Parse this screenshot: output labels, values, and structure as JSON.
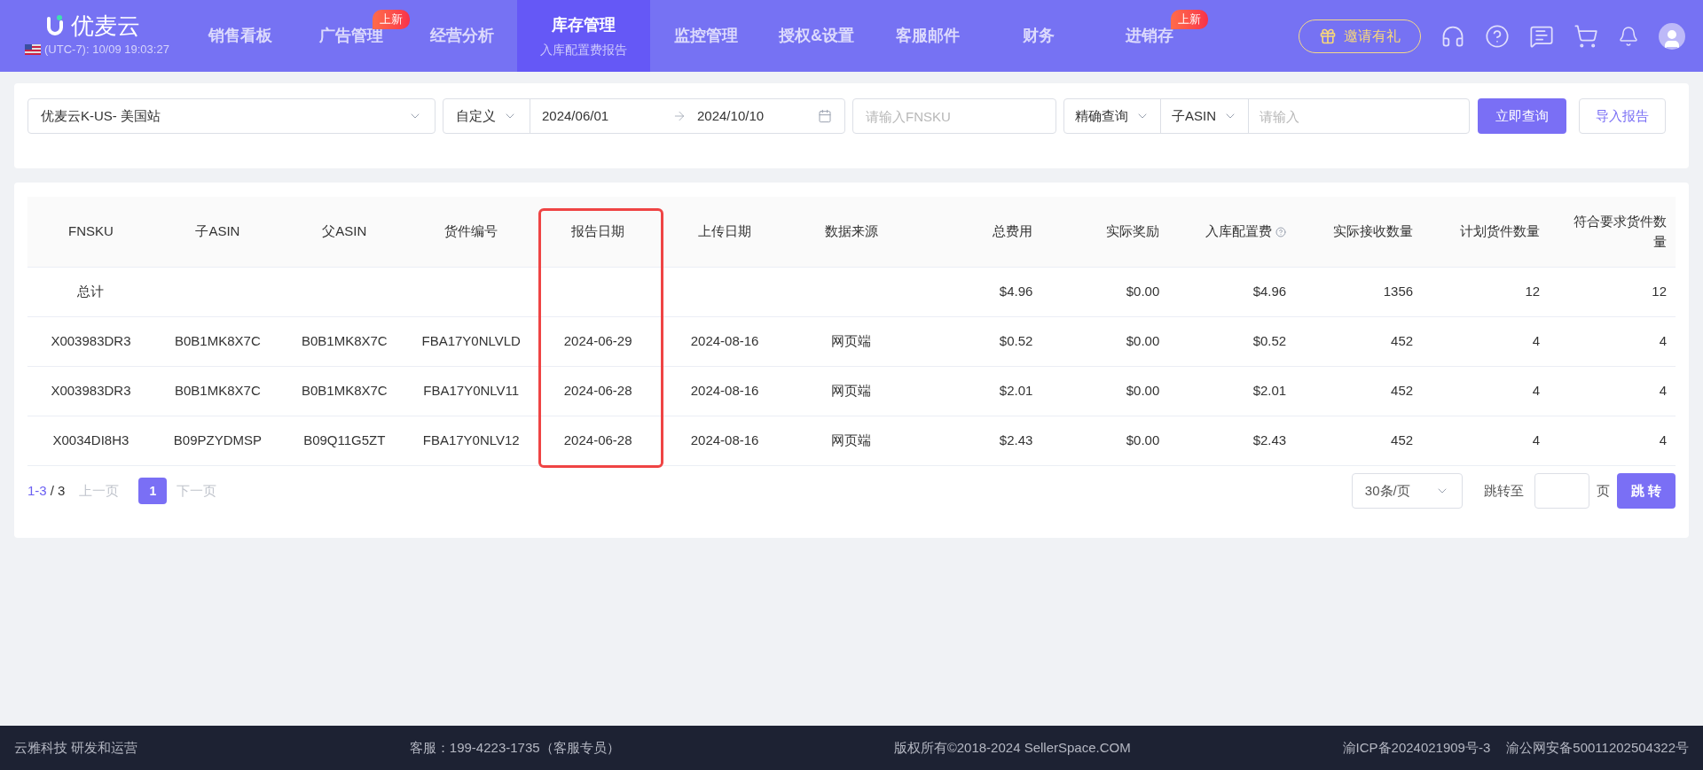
{
  "header": {
    "logo_text": "优麦云",
    "clock": "(UTC-7): 10/09 19:03:27",
    "nav": [
      {
        "label": "销售看板",
        "selected": false
      },
      {
        "label": "广告管理",
        "selected": false,
        "badge": "上新"
      },
      {
        "label": "经营分析",
        "selected": false
      },
      {
        "label": "库存管理",
        "selected": true,
        "subtitle": "入库配置费报告"
      },
      {
        "label": "监控管理",
        "selected": false
      },
      {
        "label": "授权&设置",
        "selected": false
      },
      {
        "label": "客服邮件",
        "selected": false
      },
      {
        "label": "财务",
        "selected": false
      },
      {
        "label": "进销存",
        "selected": false,
        "badge": "上新"
      }
    ],
    "invite_button": "邀请有礼"
  },
  "filters": {
    "store": "优麦云K-US- 美国站",
    "date_mode": "自定义",
    "date_start": "2024/06/01",
    "date_end": "2024/10/10",
    "fnsku_placeholder": "请输入FNSKU",
    "match_mode": "精确查询",
    "asin_type": "子ASIN",
    "asin_placeholder": "请输入",
    "search_button": "立即查询",
    "import_button": "导入报告"
  },
  "table": {
    "columns": [
      {
        "label": "FNSKU",
        "kind": "text"
      },
      {
        "label": "子ASIN",
        "kind": "text"
      },
      {
        "label": "父ASIN",
        "kind": "text"
      },
      {
        "label": "货件编号",
        "kind": "text"
      },
      {
        "label": "报告日期",
        "kind": "text",
        "highlighted": true
      },
      {
        "label": "上传日期",
        "kind": "text"
      },
      {
        "label": "数据来源",
        "kind": "text"
      },
      {
        "label": "总费用",
        "kind": "number"
      },
      {
        "label": "实际奖励",
        "kind": "number"
      },
      {
        "label": "入库配置费",
        "kind": "number",
        "help": true
      },
      {
        "label": "实际接收数量",
        "kind": "number"
      },
      {
        "label": "计划货件数量",
        "kind": "number"
      },
      {
        "label": "符合要求货件数量",
        "kind": "number"
      }
    ],
    "rows": [
      [
        "总计",
        "",
        "",
        "",
        "",
        "",
        "",
        "$4.96",
        "$0.00",
        "$4.96",
        "1356",
        "12",
        "12"
      ],
      [
        "X003983DR3",
        "B0B1MK8X7C",
        "B0B1MK8X7C",
        "FBA17Y0NLVLD",
        "2024-06-29",
        "2024-08-16",
        "网页端",
        "$0.52",
        "$0.00",
        "$0.52",
        "452",
        "4",
        "4"
      ],
      [
        "X003983DR3",
        "B0B1MK8X7C",
        "B0B1MK8X7C",
        "FBA17Y0NLV11",
        "2024-06-28",
        "2024-08-16",
        "网页端",
        "$2.01",
        "$0.00",
        "$2.01",
        "452",
        "4",
        "4"
      ],
      [
        "X0034DI8H3",
        "B09PZYDMSP",
        "B09Q11G5ZT",
        "FBA17Y0NLV12",
        "2024-06-28",
        "2024-08-16",
        "网页端",
        "$2.43",
        "$0.00",
        "$2.43",
        "452",
        "4",
        "4"
      ]
    ]
  },
  "pagination": {
    "range": "1-3",
    "total": "/ 3",
    "prev": {
      "label": "上一页",
      "disabled": true
    },
    "pages": [
      {
        "label": "1",
        "selected": true
      }
    ],
    "next": {
      "label": "下一页",
      "disabled": true
    },
    "page_size": "30条/页",
    "jump_label": "跳转至",
    "jump_unit": "页",
    "jump_button": "跳 转"
  },
  "footer": [
    "云雅科技 研发和运营",
    "客服：199-4223-1735（客服专员）",
    "版权所有©2018-2024 SellerSpace.COM",
    "渝ICP备2024021909号-3",
    "渝公网安备50011202504322号"
  ]
}
